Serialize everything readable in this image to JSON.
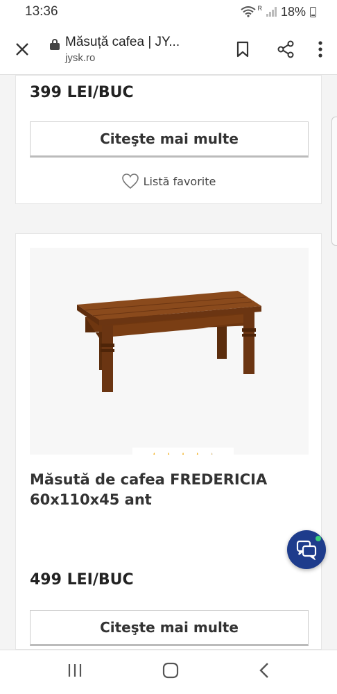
{
  "status_bar": {
    "time": "13:36",
    "battery": "18%",
    "network_label": "R"
  },
  "browser": {
    "tab_title": "Măsuță cafea | JY...",
    "domain": "jysk.ro"
  },
  "product_prev": {
    "price": "399 LEI/BUC",
    "read_more": "Citeşte mai multe",
    "favorite": "Listă favorite"
  },
  "product": {
    "name": "Măsută de cafea FREDERICIA 60x110x45 ant",
    "rating": 4.5,
    "rating_max": 5,
    "price": "499 LEI/BUC",
    "read_more": "Citeşte mai multe"
  },
  "colors": {
    "accent": "#1e3c8c",
    "star": "#f0a500",
    "wood": "#7a3e14"
  }
}
